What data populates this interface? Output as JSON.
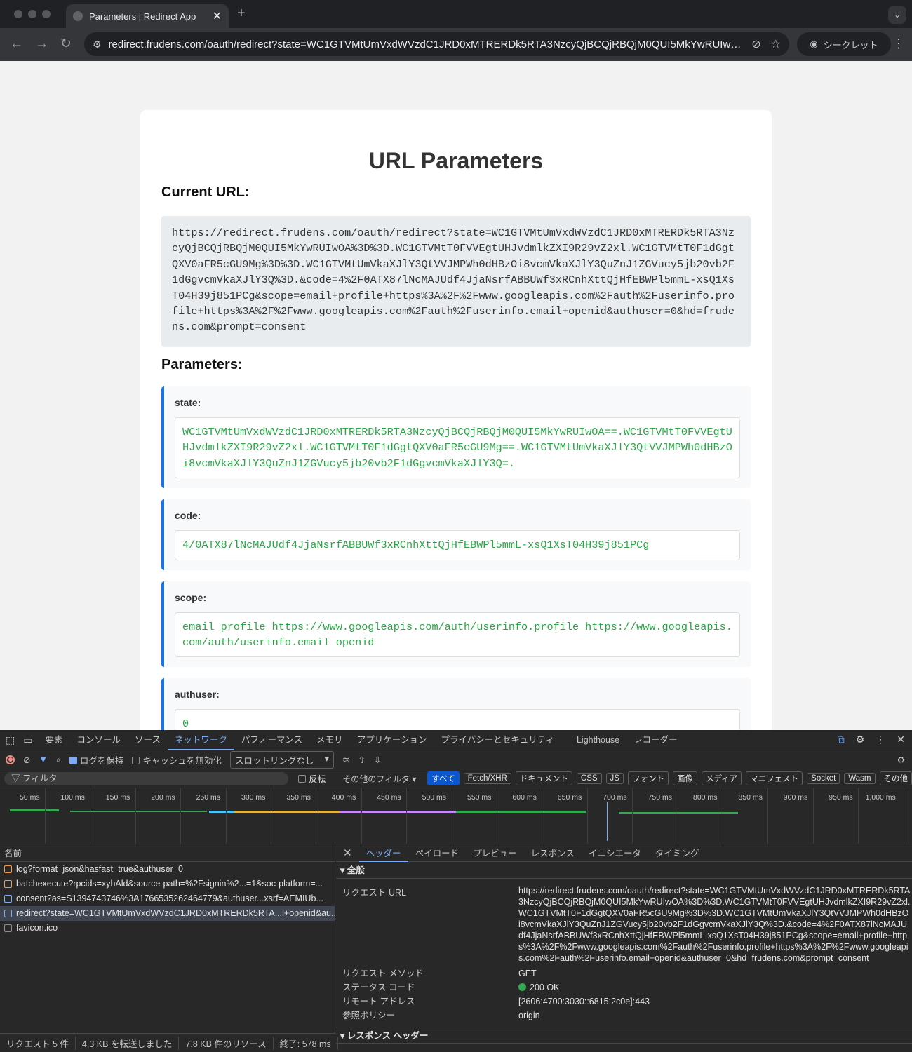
{
  "browser": {
    "tab_title": "Parameters | Redirect App",
    "address": "redirect.frudens.com/oauth/redirect?state=WC1GTVMtUmVxdWVzdC1JRD0xMTRERDk5RTA3NzcyQjBCQjRBQjM0QUI5MkYwRUIwOA...",
    "incognito_label": "シークレット"
  },
  "page": {
    "title": "URL Parameters",
    "current_url_heading": "Current URL:",
    "current_url": "https://redirect.frudens.com/oauth/redirect?state=WC1GTVMtUmVxdWVzdC1JRD0xMTRERDk5RTA3NzcyQjBCQjRBQjM0QUI5MkYwRUIwOA%3D%3D.WC1GTVMtT0FVVEgtUHJvdmlkZXI9R29vZ2xl.WC1GTVMtT0F1dGgtQXV0aFR5cGU9Mg%3D%3D.WC1GTVMtUmVkaXJlY3QtVVJMPWh0dHBzOi8vcmVkaXJlY3QuZnJ1ZGVucy5jb20vb2F1dGgvcmVkaXJlY3Q%3D.&code=4%2F0ATX87lNcMAJUdf4JjaNsrfABBUWf3xRCnhXttQjHfEBWPl5mmL-xsQ1XsT04H39j851PCg&scope=email+profile+https%3A%2F%2Fwww.googleapis.com%2Fauth%2Fuserinfo.profile+https%3A%2F%2Fwww.googleapis.com%2Fauth%2Fuserinfo.email+openid&authuser=0&hd=frudens.com&prompt=consent",
    "params_heading": "Parameters:",
    "params": [
      {
        "name": "state:",
        "value": "WC1GTVMtUmVxdWVzdC1JRD0xMTRERDk5RTA3NzcyQjBCQjRBQjM0QUI5MkYwRUIwOA==.WC1GTVMtT0FVVEgtUHJvdmlkZXI9R29vZ2xl.WC1GTVMtT0F1dGgtQXV0aFR5cGU9Mg==.WC1GTVMtUmVkaXJlY3QtVVJMPWh0dHBzOi8vcmVkaXJlY3QuZnJ1ZGVucy5jb20vb2F1dGgvcmVkaXJlY3Q=."
      },
      {
        "name": "code:",
        "value": "4/0ATX87lNcMAJUdf4JjaNsrfABBUWf3xRCnhXttQjHfEBWPl5mmL-xsQ1XsT04H39j851PCg"
      },
      {
        "name": "scope:",
        "value": "email profile https://www.googleapis.com/auth/userinfo.profile https://www.googleapis.com/auth/userinfo.email openid"
      },
      {
        "name": "authuser:",
        "value": "0"
      }
    ]
  },
  "devtools": {
    "tabs": [
      "要素",
      "コンソール",
      "ソース",
      "ネットワーク",
      "パフォーマンス",
      "メモリ",
      "アプリケーション",
      "プライバシーとセキュリティ",
      "Lighthouse",
      "レコーダー"
    ],
    "toolbar": {
      "preserve_log": "ログを保持",
      "disable_cache": "キャッシュを無効化",
      "throttling": "スロットリングなし"
    },
    "filter": {
      "placeholder": "フィルタ",
      "invert": "反転",
      "more_filters": "その他のフィルタ",
      "types": [
        "すべて",
        "Fetch/XHR",
        "ドキュメント",
        "CSS",
        "JS",
        "フォント",
        "画像",
        "メディア",
        "マニフェスト",
        "Socket",
        "Wasm",
        "その他"
      ]
    },
    "timeline_ticks": [
      "50 ms",
      "100 ms",
      "150 ms",
      "200 ms",
      "250 ms",
      "300 ms",
      "350 ms",
      "400 ms",
      "450 ms",
      "500 ms",
      "550 ms",
      "600 ms",
      "650 ms",
      "700 ms",
      "750 ms",
      "800 ms",
      "850 ms",
      "900 ms",
      "950 ms",
      "1,000 ms"
    ],
    "request_list": {
      "header": "名前",
      "rows": [
        "log?format=json&hasfast=true&authuser=0",
        "batchexecute?rpcids=xyhAld&source-path=%2Fsignin%2...=1&soc-platform=...",
        "consent?as=S1394743746%3A1766535262464779&authuser...xsrf=AEMIUb...",
        "redirect?state=WC1GTVMtUmVxdWVzdC1JRD0xMTRERDk5RTA...l+openid&au...",
        "favicon.ico"
      ]
    },
    "detail_tabs": [
      "ヘッダー",
      "ペイロード",
      "プレビュー",
      "レスポンス",
      "イニシエータ",
      "タイミング"
    ],
    "general_section": "▾ 全般",
    "general": [
      {
        "k": "リクエスト URL",
        "v": "https://redirect.frudens.com/oauth/redirect?state=WC1GTVMtUmVxdWVzdC1JRD0xMTRERDk5RTA3NzcyQjBCQjRBQjM0QUI5MkYwRUIwOA%3D%3D.WC1GTVMtT0FVVEgtUHJvdmlkZXI9R29vZ2xl.WC1GTVMtT0F1dGgtQXV0aFR5cGU9Mg%3D%3D.WC1GTVMtUmVkaXJlY3QtVVJMPWh0dHBzOi8vcmVkaXJlY3QuZnJ1ZGVucy5jb20vb2F1dGgvcmVkaXJlY3Q%3D.&code=4%2F0ATX87lNcMAJUdf4JjaNsrfABBUWf3xRCnhXttQjHfEBWPl5mmL-xsQ1XsT04H39j851PCg&scope=email+profile+https%3A%2F%2Fwww.googleapis.com%2Fauth%2Fuserinfo.profile+https%3A%2F%2Fwww.googleapis.com%2Fauth%2Fuserinfo.email+openid&authuser=0&hd=frudens.com&prompt=consent"
      },
      {
        "k": "リクエスト メソッド",
        "v": "GET"
      },
      {
        "k": "ステータス コード",
        "v": "200 OK"
      },
      {
        "k": "リモート アドレス",
        "v": "[2606:4700:3030::6815:2c0e]:443"
      },
      {
        "k": "参照ポリシー",
        "v": "origin"
      }
    ],
    "response_section": "▾ レスポンス ヘッダー",
    "status_bar": [
      "リクエスト 5 件",
      "4.3 KB を転送しました",
      "7.8 KB 件のリソース",
      "終了: 578 ms"
    ],
    "colors": {
      "accent": "#7cacf8",
      "status_ok": "#34a853",
      "param_value": "#28a745",
      "param_border": "#1a73e8"
    }
  }
}
